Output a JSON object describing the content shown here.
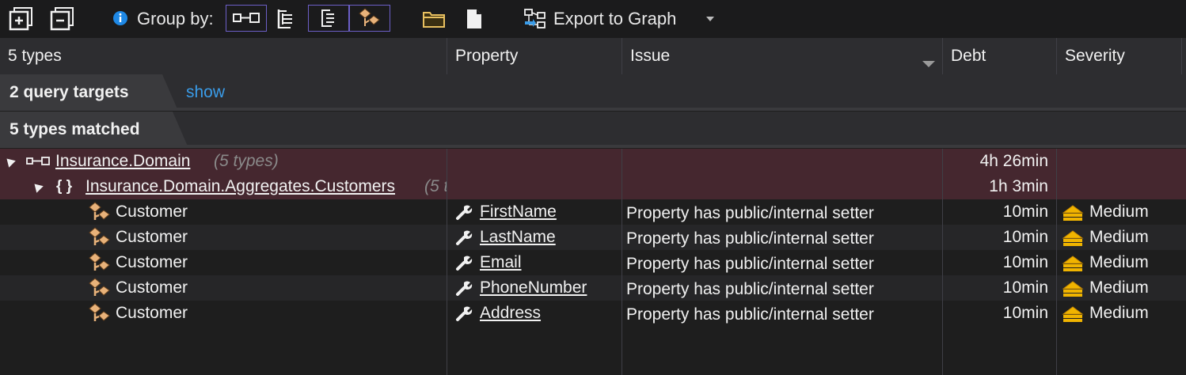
{
  "toolbar": {
    "group_by_label": "Group by:",
    "export_label": "Export to Graph",
    "icons": [
      "expand-all-icon",
      "collapse-all-icon",
      "info-icon",
      "group-assembly-icon",
      "group-namespace-icon",
      "group-type-icon",
      "group-member-icon",
      "folder-icon",
      "file-icon",
      "export-graph-icon",
      "dropdown-arrow-icon"
    ]
  },
  "columns": {
    "name": "5 types",
    "property": "Property",
    "issue": "Issue",
    "debt": "Debt",
    "severity": "Severity"
  },
  "bands": {
    "query_targets": "2 query targets",
    "show_link": "show",
    "matched": "5 types matched"
  },
  "groups": {
    "assembly": {
      "name": "Insurance.Domain",
      "count": "(5 types)",
      "debt": "4h  26min"
    },
    "namespace": {
      "name": "Insurance.Domain.Aggregates.Customers",
      "count": "(5 t",
      "debt": "1h  3min"
    }
  },
  "rows": [
    {
      "type": "Customer",
      "property": "FirstName",
      "issue": "Property has public/internal setter",
      "debt": "10min",
      "severity": "Medium"
    },
    {
      "type": "Customer",
      "property": "LastName",
      "issue": "Property has public/internal setter",
      "debt": "10min",
      "severity": "Medium"
    },
    {
      "type": "Customer",
      "property": "Email",
      "issue": "Property has public/internal setter",
      "debt": "10min",
      "severity": "Medium"
    },
    {
      "type": "Customer",
      "property": "PhoneNumber",
      "issue": "Property has public/internal setter",
      "debt": "10min",
      "severity": "Medium"
    },
    {
      "type": "Customer",
      "property": "Address",
      "issue": "Property has public/internal setter",
      "debt": "10min",
      "severity": "Medium"
    }
  ],
  "colors": {
    "accent_link": "#3a9ce8",
    "group_row": "#45272f",
    "severity_medium": "#f0b400"
  }
}
